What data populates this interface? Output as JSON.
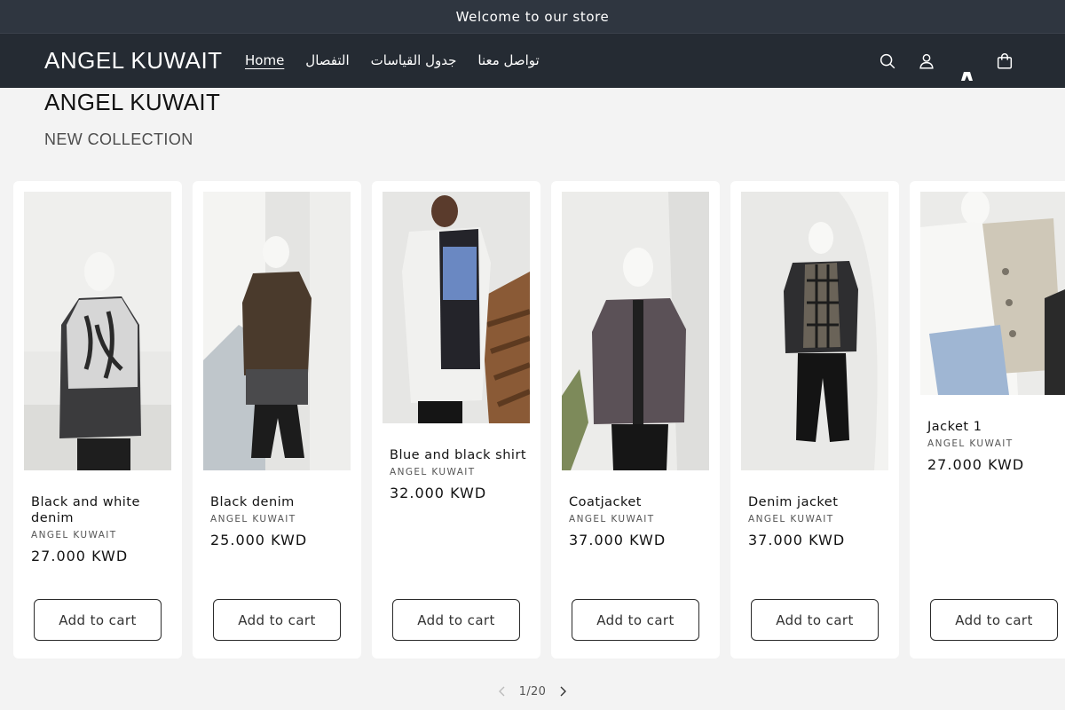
{
  "announcement": "Welcome to our store",
  "header": {
    "logo": "ANGEL KUWAIT",
    "nav": [
      {
        "label": "Home",
        "active": true
      },
      {
        "label": "التفصال",
        "active": false
      },
      {
        "label": "جدول القياسات",
        "active": false
      },
      {
        "label": "تواصل معنا",
        "active": false
      }
    ],
    "icons": [
      "search-icon",
      "account-icon",
      "flag-icon",
      "cart-icon"
    ]
  },
  "section": {
    "title": "ANGEL KUWAIT",
    "subtitle": "NEW COLLECTION"
  },
  "products": [
    {
      "name": "Black and white denim",
      "vendor": "ANGEL KUWAIT",
      "price": "27.000 KWD",
      "cta": "Add to cart"
    },
    {
      "name": "Black denim",
      "vendor": "ANGEL KUWAIT",
      "price": "25.000 KWD",
      "cta": "Add to cart"
    },
    {
      "name": "Blue and black shirt",
      "vendor": "ANGEL KUWAIT",
      "price": "32.000 KWD",
      "cta": "Add to cart"
    },
    {
      "name": "Coatjacket",
      "vendor": "ANGEL KUWAIT",
      "price": "37.000 KWD",
      "cta": "Add to cart"
    },
    {
      "name": "Denim jacket",
      "vendor": "ANGEL KUWAIT",
      "price": "37.000 KWD",
      "cta": "Add to cart"
    },
    {
      "name": "Jacket 1",
      "vendor": "ANGEL KUWAIT",
      "price": "27.000 KWD",
      "cta": "Add to cart"
    }
  ],
  "slider": {
    "counter": "1/20",
    "prev_icon": "chevron-left-icon",
    "next_icon": "chevron-right-icon"
  },
  "colors": {
    "announcement_bg": "#2f3640",
    "header_bg": "#252b33",
    "page_bg": "#f3f3f3",
    "card_bg": "#ffffff"
  }
}
